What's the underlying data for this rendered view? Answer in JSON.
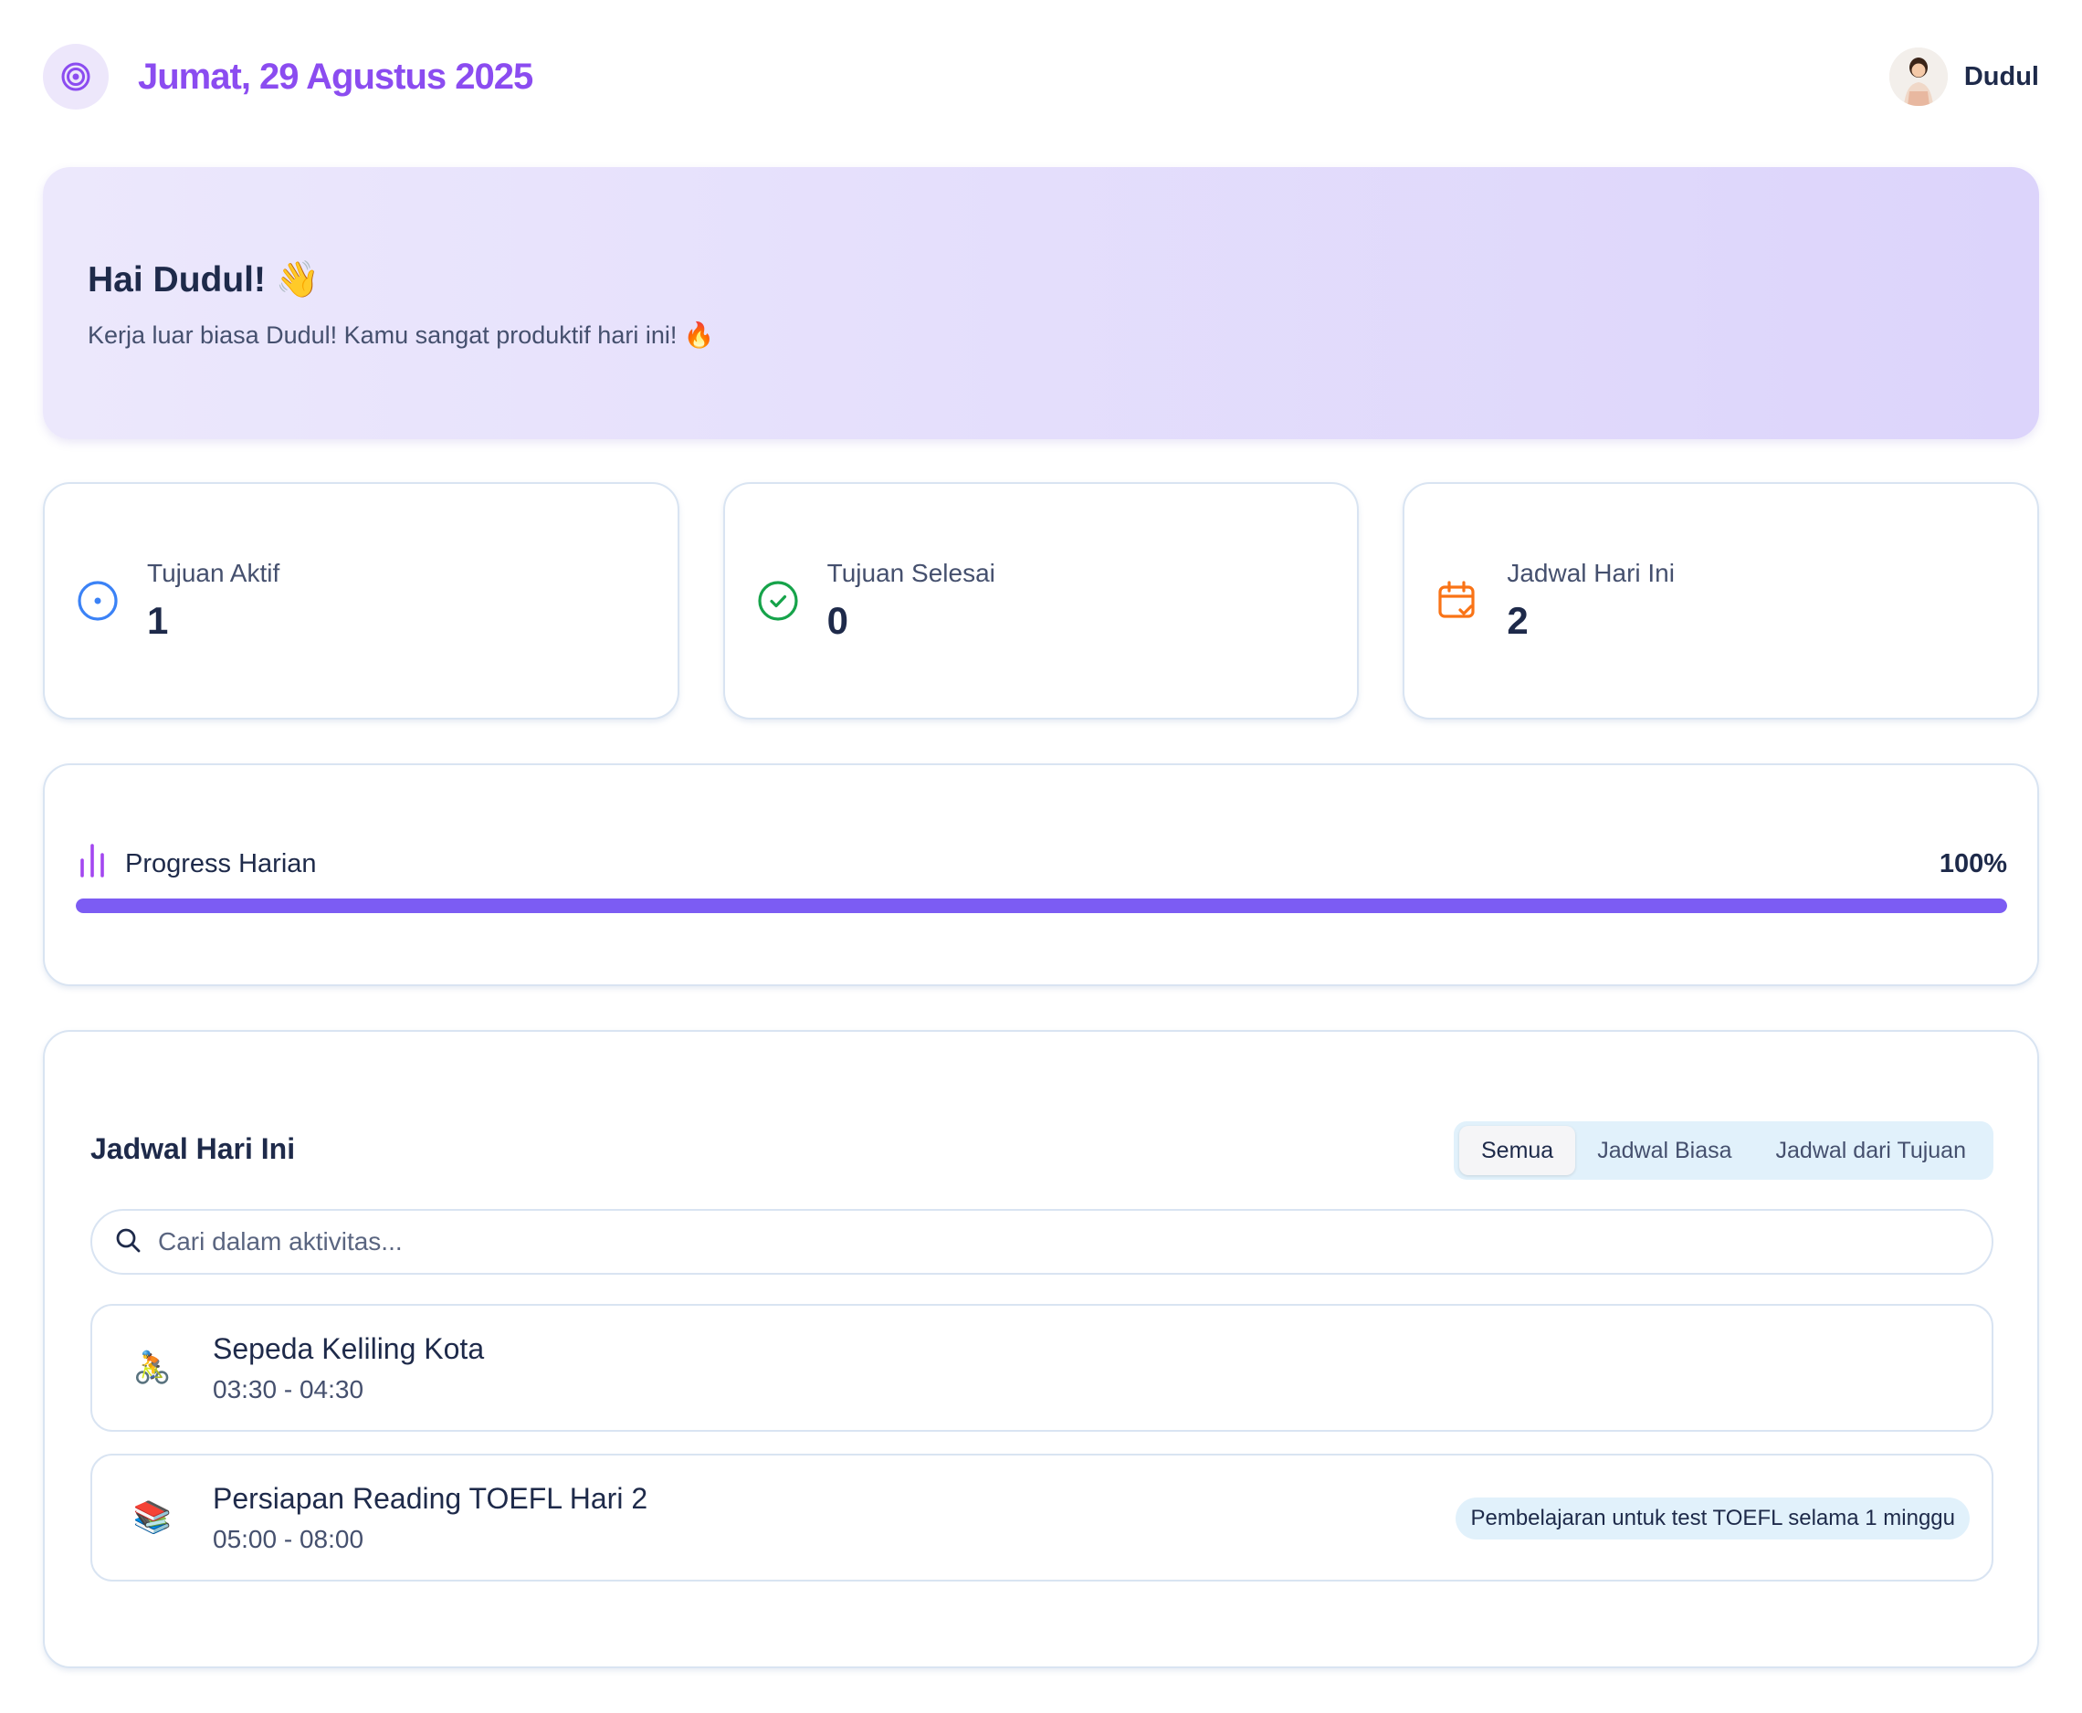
{
  "header": {
    "date_title": "Jumat, 29 Agustus 2025",
    "logo_icon": "target-icon",
    "user_name": "Dudul"
  },
  "hero": {
    "greeting": "Hai Dudul! 👋",
    "message": "Kerja luar biasa Dudul! Kamu sangat produktif hari ini! 🔥"
  },
  "stats": [
    {
      "label": "Tujuan Aktif",
      "value": "1",
      "icon": "target-circle-icon",
      "color": "#3b82f6"
    },
    {
      "label": "Tujuan Selesai",
      "value": "0",
      "icon": "check-circle-icon",
      "color": "#16a34a"
    },
    {
      "label": "Jadwal Hari Ini",
      "value": "2",
      "icon": "calendar-check-icon",
      "color": "#f97316"
    }
  ],
  "progress": {
    "title": "Progress Harian",
    "percent_label": "100%",
    "percent": 100
  },
  "schedule": {
    "title": "Jadwal Hari Ini",
    "tabs": [
      "Semua",
      "Jadwal Biasa",
      "Jadwal dari Tujuan"
    ],
    "active_tab": "Semua",
    "search_placeholder": "Cari dalam aktivitas...",
    "activities": [
      {
        "emoji": "🚴",
        "title": "Sepeda Keliling Kota",
        "time": "03:30 - 04:30",
        "badge": ""
      },
      {
        "emoji": "📚",
        "title": "Persiapan Reading TOEFL Hari 2",
        "time": "05:00 - 08:00",
        "badge": "Pembelajaran untuk test TOEFL selama 1 minggu"
      }
    ]
  },
  "colors": {
    "accent": "#8b4cf0",
    "progress_fill": "#7c5cf3",
    "card_border": "#d9e4f2"
  }
}
